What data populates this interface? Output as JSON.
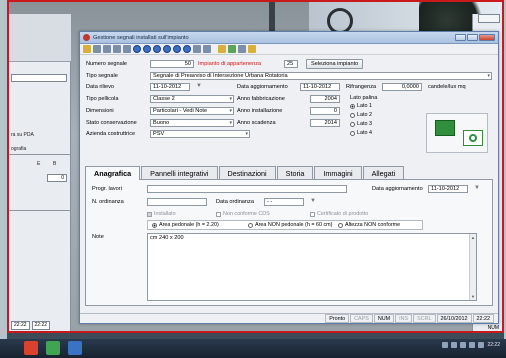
{
  "window": {
    "title": "Gestione segnali installati sull'impianto"
  },
  "form": {
    "numero_segnale_label": "Numero segnale",
    "numero_segnale_value": "50",
    "impianto_label": "Impianto di appartenenza",
    "impianto_value": "25",
    "seleziona_impianto_button": "Seleziona impianto",
    "tipo_segnale_label": "Tipo segnale",
    "tipo_segnale_value": "Segnale di Preavviso di Intersezione Urbana Rotatoria",
    "data_rilievo_label": "Data rilievo",
    "data_rilievo_value": "11-10-2012",
    "data_aggiornamento_label": "Data aggiornamento",
    "data_aggiornamento_value": "11-10-2012",
    "rifrangenza_label": "Rifrangenza",
    "rifrangenza_value": "0,0000",
    "rifrangenza_unit": "candele/lux mq",
    "tipo_pellicola_label": "Tipo pellicola",
    "tipo_pellicola_value": "Classe 2",
    "anno_fabbricazione_label": "Anno fabbricazione",
    "anno_fabbricazione_value": "2004",
    "lato_palina_label": "Lato palina",
    "dimensioni_label": "Dimensioni",
    "dimensioni_value": "Particolari - Vedi Note",
    "anno_installazione_label": "Anno installazione",
    "anno_installazione_value": "0",
    "stato_conservazione_label": "Stato conservazione",
    "stato_conservazione_value": "Buono",
    "anno_scadenza_label": "Anno scadenza",
    "anno_scadenza_value": "2014",
    "azienda_label": "Azienda costruttrice",
    "azienda_value": "PSV",
    "lati": [
      "Lato 1",
      "Lato 2",
      "Lato 3",
      "Lato 4"
    ]
  },
  "tabs": [
    "Anagrafica",
    "Pannelli integrativi",
    "Destinazioni",
    "Storia",
    "Immagini",
    "Allegati"
  ],
  "anagrafica": {
    "prog_lavori_label": "Progr. lavori",
    "data_aggiornamento_label": "Data aggiornamento",
    "data_aggiornamento_value": "11-10-2012",
    "n_ordinanza_label": "N. ordinanza",
    "data_ordinanza_label": "Data ordinanza",
    "data_ordinanza_value": "- -",
    "chk_installato": "Installato",
    "chk_non_conforme": "Non conforme CDS",
    "chk_certificato": "Certificato di prodotto",
    "radio_pedonale": "Area pedonale (h = 2.20)",
    "radio_non_pedonale": "Area NON pedonale (h = 60 cm)",
    "radio_altezza": "Altezza NON conforme",
    "note_label": "Note",
    "note_value": "cm 240 x 200"
  },
  "status": {
    "pronto": "Pronto",
    "caps": "CAPS",
    "num": "NUM",
    "ins": "INS",
    "scrl": "SCRL",
    "date": "26/10/2012",
    "time": "22:22"
  },
  "bgapp": {
    "label1": "ra su PDA",
    "label2": "ografia",
    "col_e": "E",
    "col_b": "B",
    "val0": "0",
    "time1": "22:22",
    "time2": "22:22",
    "num": "NUM"
  },
  "taskbar": {
    "clock": "22:22"
  },
  "colors": {
    "accent": "#2f8f3d",
    "red_text": "#dd1111",
    "frame": "#c81a1a"
  }
}
